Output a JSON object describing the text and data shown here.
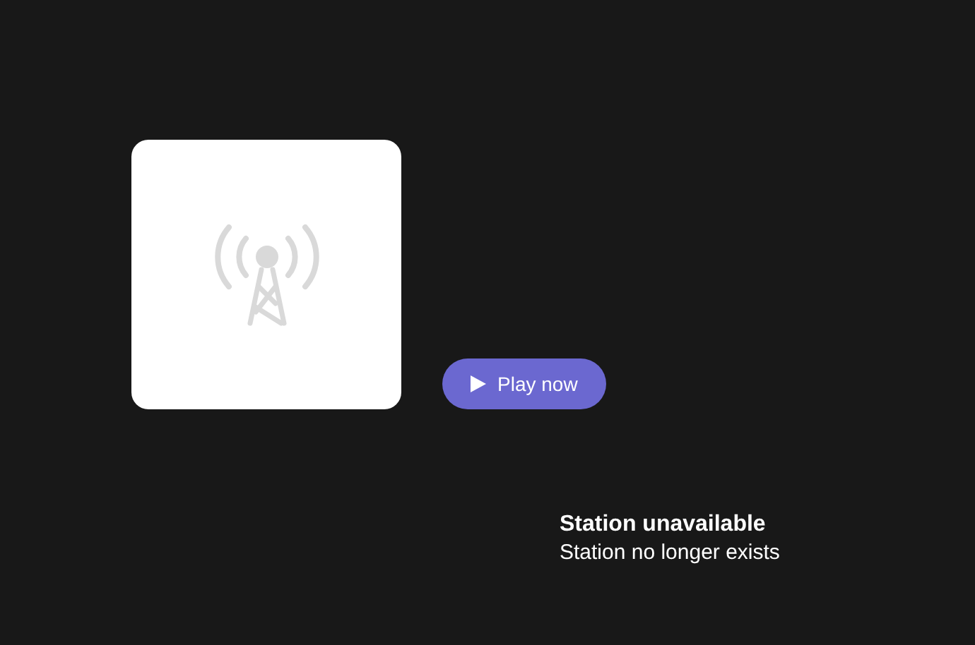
{
  "play_button": {
    "label": "Play now"
  },
  "status": {
    "title": "Station unavailable",
    "message": "Station no longer exists"
  }
}
